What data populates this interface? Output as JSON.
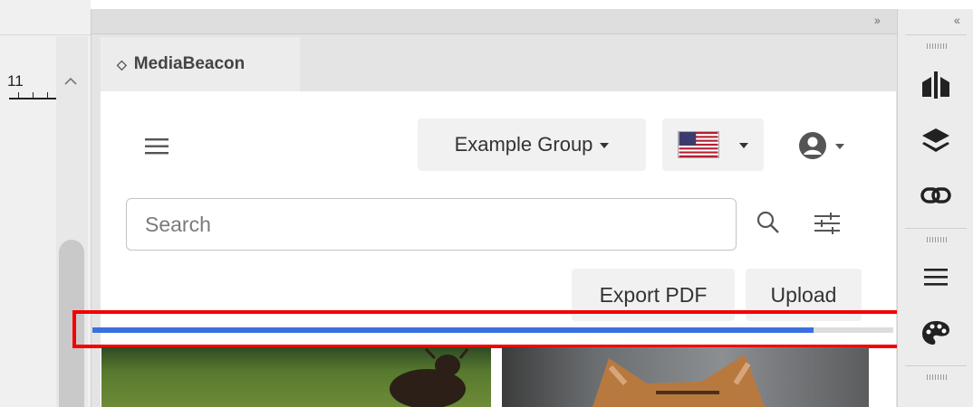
{
  "ruler": {
    "number": "11"
  },
  "panel": {
    "collapse_label": "››",
    "tab": {
      "chevron": "◇",
      "title": "MediaBeacon"
    }
  },
  "header": {
    "group_label": "Example Group",
    "language_flag": "us-flag-icon"
  },
  "search": {
    "placeholder": "Search",
    "value": ""
  },
  "actions": {
    "export_label": "Export PDF",
    "upload_label": "Upload"
  },
  "progress": {
    "fraction": 0.9,
    "color": "#3a6fe0"
  },
  "right_toolbar": {
    "collapse_label": "‹‹",
    "icons": [
      "cloud-sync-icon",
      "layers-icon",
      "link-icon",
      "menu-lines-icon",
      "palette-icon"
    ]
  },
  "colors": {
    "highlight": "#f40000",
    "accent": "#3a6fe0"
  }
}
